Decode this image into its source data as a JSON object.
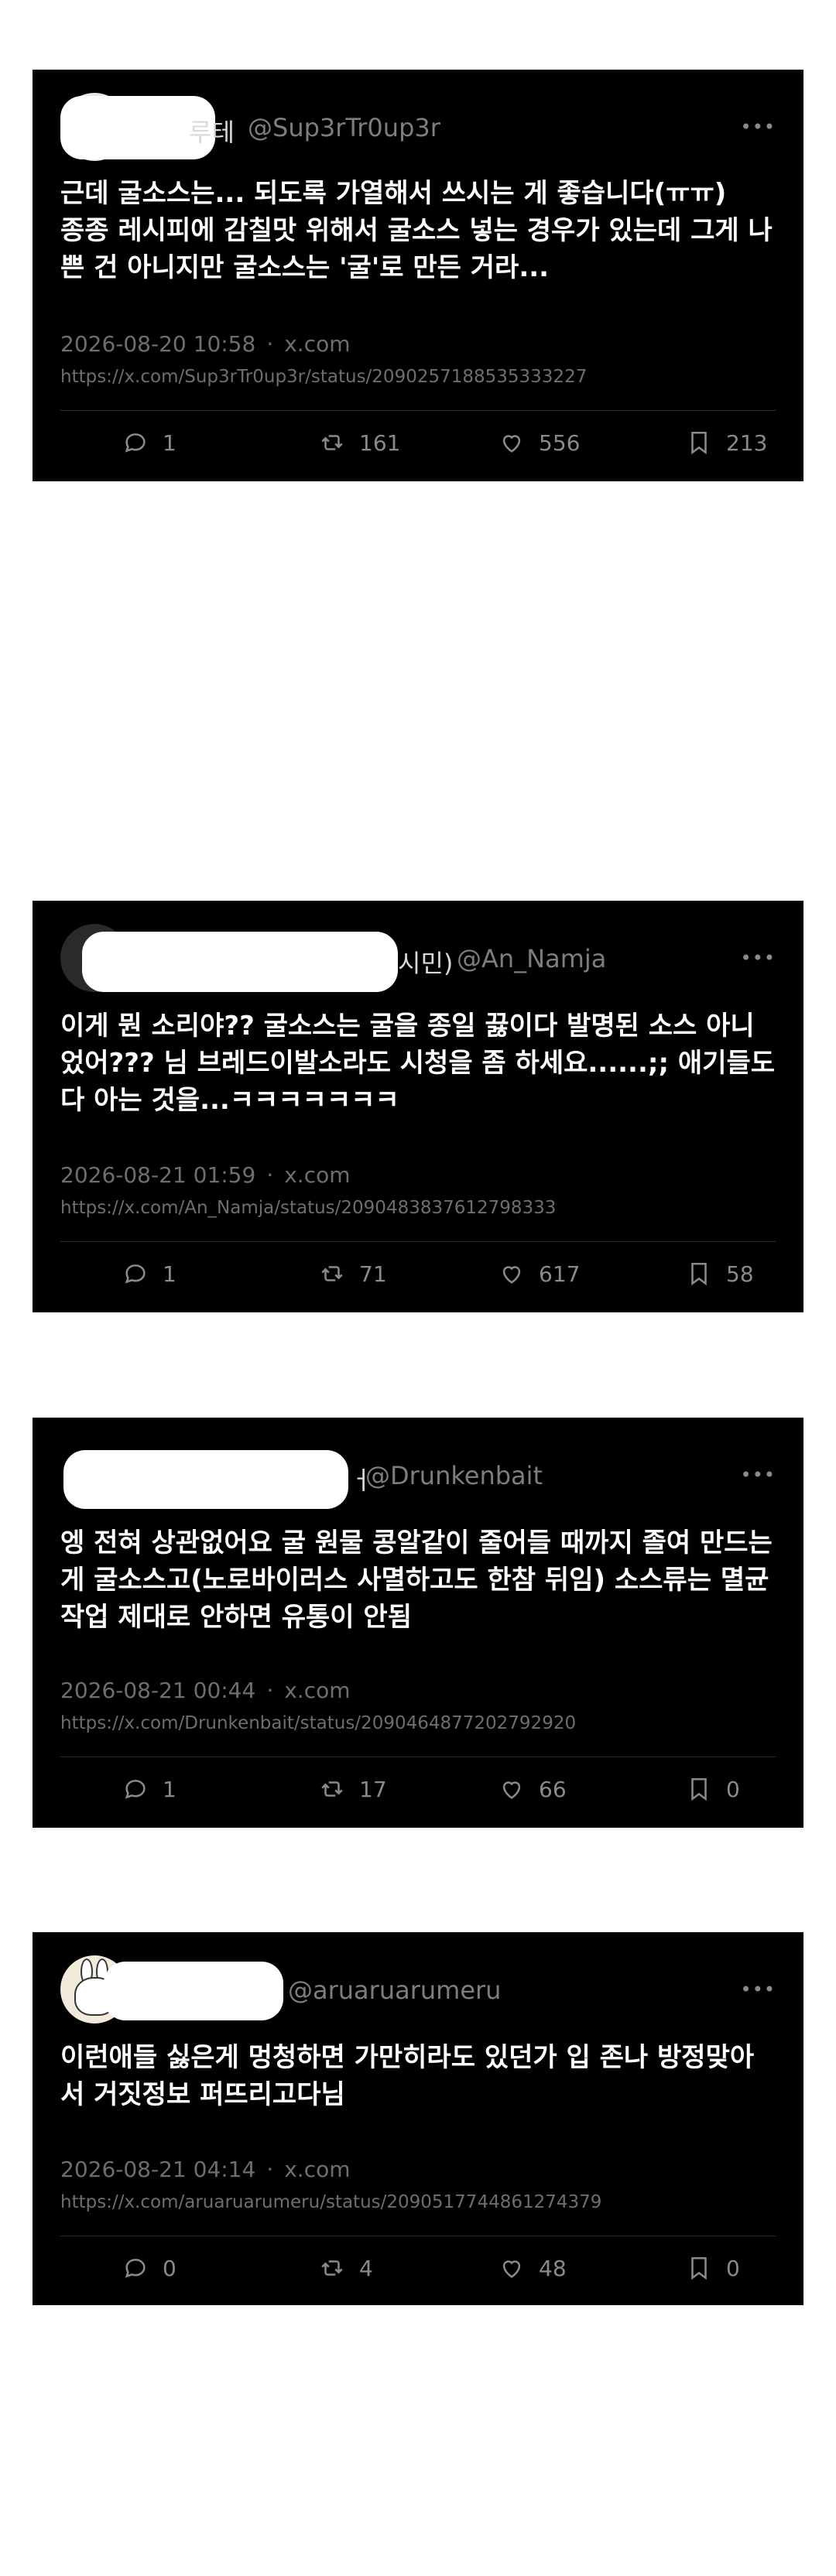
{
  "icons": {
    "reply": "reply-icon",
    "retweet": "retweet-icon",
    "like": "heart-icon",
    "bookmark": "bookmark-icon",
    "more": "more-icon"
  },
  "colors": {
    "card_bg": "#000000",
    "text": "#ffffff",
    "muted": "#6e6e6e",
    "page_bg": "#ffffff"
  },
  "tweets": [
    {
      "name_tail": "루테",
      "handle": "@Sup3rTr0up3r",
      "more": "•••",
      "text": "근데 굴소스는... 되도록 가열해서 쓰시는 게 좋습니다(ㅠㅠ)\n종종 레시피에 감칠맛 위해서 굴소스 넣는 경우가 있는데 그게 나쁜 건 아니지만 굴소스는 '굴'로 만든 거라...",
      "date": "2026-08-20 10:58",
      "dot": "·",
      "source": "x.com",
      "url": "https://x.com/Sup3rTr0up3r/status/2090257188535333227",
      "replies": "1",
      "retweets": "161",
      "likes": "556",
      "bookmarks": "213"
    },
    {
      "name_tail": "시민)",
      "handle": "@An_Namja",
      "more": "•••",
      "text": "이게 뭔 소리야?? 굴소스는 굴을 종일 끓이다 발명된 소스 아니었어??? 님 브레드이발소라도 시청을 좀 하세요......;; 애기들도 다 아는 것을...ㅋㅋㅋㅋㅋㅋㅋ",
      "date": "2026-08-21 01:59",
      "dot": "·",
      "source": "x.com",
      "url": "https://x.com/An_Namja/status/2090483837612798333",
      "replies": "1",
      "retweets": "71",
      "likes": "617",
      "bookmarks": "58"
    },
    {
      "name_tail": "ㅓ",
      "handle": "@Drunkenbait",
      "more": "•••",
      "text": "엥 전혀 상관없어요 굴 원물 콩알같이 줄어들 때까지 졸여 만드는게 굴소스고(노로바이러스 사멸하고도 한참 뒤임) 소스류는 멸균작업 제대로 안하면 유통이 안됨",
      "date": "2026-08-21 00:44",
      "dot": "·",
      "source": "x.com",
      "url": "https://x.com/Drunkenbait/status/2090464877202792920",
      "replies": "1",
      "retweets": "17",
      "likes": "66",
      "bookmarks": "0"
    },
    {
      "name_tail": "",
      "handle": "@aruaruarumeru",
      "more": "•••",
      "text": "이런애들 싫은게 멍청하면 가만히라도 있던가 입 존나 방정맞아서 거짓정보 퍼뜨리고다님",
      "date": "2026-08-21 04:14",
      "dot": "·",
      "source": "x.com",
      "url": "https://x.com/aruaruarumeru/status/2090517744861274379",
      "replies": "0",
      "retweets": "4",
      "likes": "48",
      "bookmarks": "0"
    }
  ]
}
